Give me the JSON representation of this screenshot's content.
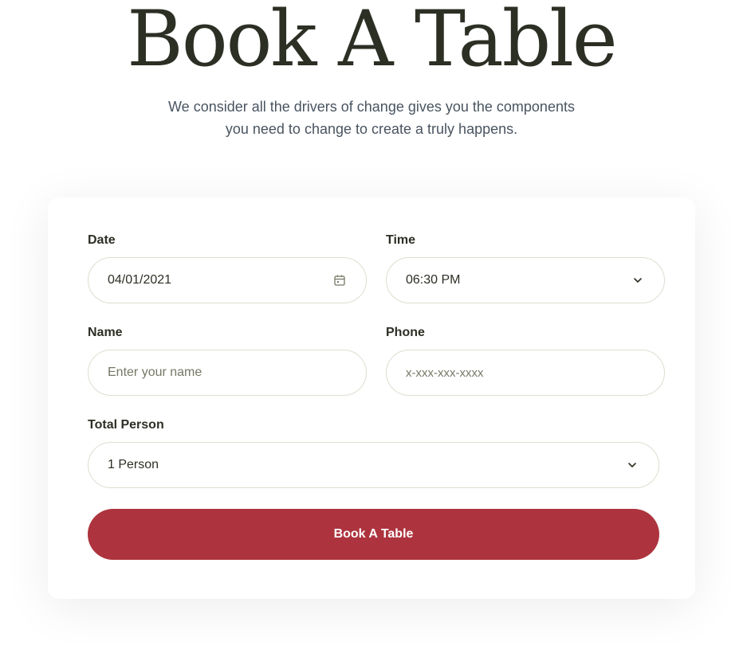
{
  "header": {
    "title": "Book A Table",
    "subtitle_line1": "We consider all the drivers of change gives you the components",
    "subtitle_line2": "you need to change to create a truly happens."
  },
  "form": {
    "date": {
      "label": "Date",
      "value": "04/01/2021",
      "icon": "calendar-icon"
    },
    "time": {
      "label": "Time",
      "value": "06:30 PM",
      "icon": "chevron-down-icon"
    },
    "name": {
      "label": "Name",
      "placeholder": "Enter your name"
    },
    "phone": {
      "label": "Phone",
      "placeholder": "x-xxx-xxx-xxxx"
    },
    "persons": {
      "label": "Total Person",
      "value": "1 Person",
      "icon": "chevron-down-icon"
    },
    "submit_label": "Book A Table"
  },
  "colors": {
    "accent": "#ad343e",
    "heading": "#2c2f24",
    "body_text": "#495460",
    "border": "#dbdfd0"
  }
}
